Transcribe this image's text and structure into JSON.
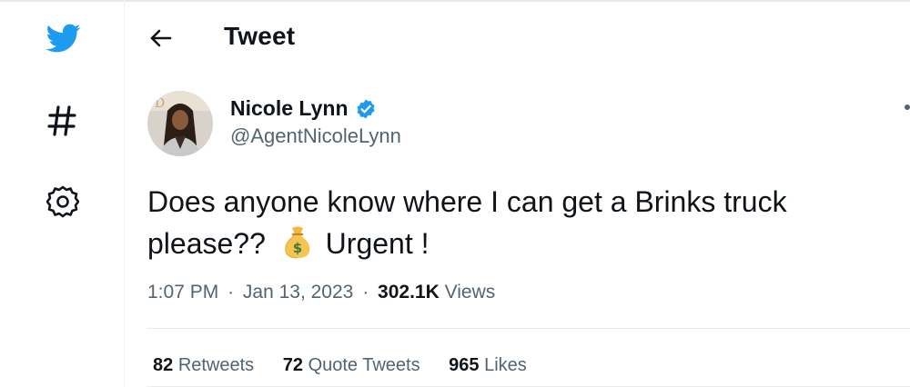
{
  "colors": {
    "brand": "#1d9bf0",
    "text": "#0f1419",
    "secondary": "#536471"
  },
  "sidebar": {
    "items": [
      {
        "icon": "twitter-bird-icon"
      },
      {
        "icon": "hashtag-icon"
      },
      {
        "icon": "settings-gear-icon"
      }
    ]
  },
  "header": {
    "back_icon": "back-arrow-icon",
    "title": "Tweet"
  },
  "tweet": {
    "author_name": "Nicole Lynn",
    "verified": true,
    "handle": "@AgentNicoleLynn",
    "text_line1": "Does anyone know where I can get a Brinks truck",
    "text_line2_before": "please??",
    "emoji": "money-bag-icon",
    "text_line2_after": "Urgent !",
    "time": "1:07 PM",
    "separator": "·",
    "date": "Jan 13, 2023",
    "views_count": "302.1K",
    "views_label": "Views"
  },
  "stats": {
    "retweets_count": "82",
    "retweets_label": "Retweets",
    "quotes_count": "72",
    "quotes_label": "Quote Tweets",
    "likes_count": "965",
    "likes_label": "Likes"
  }
}
